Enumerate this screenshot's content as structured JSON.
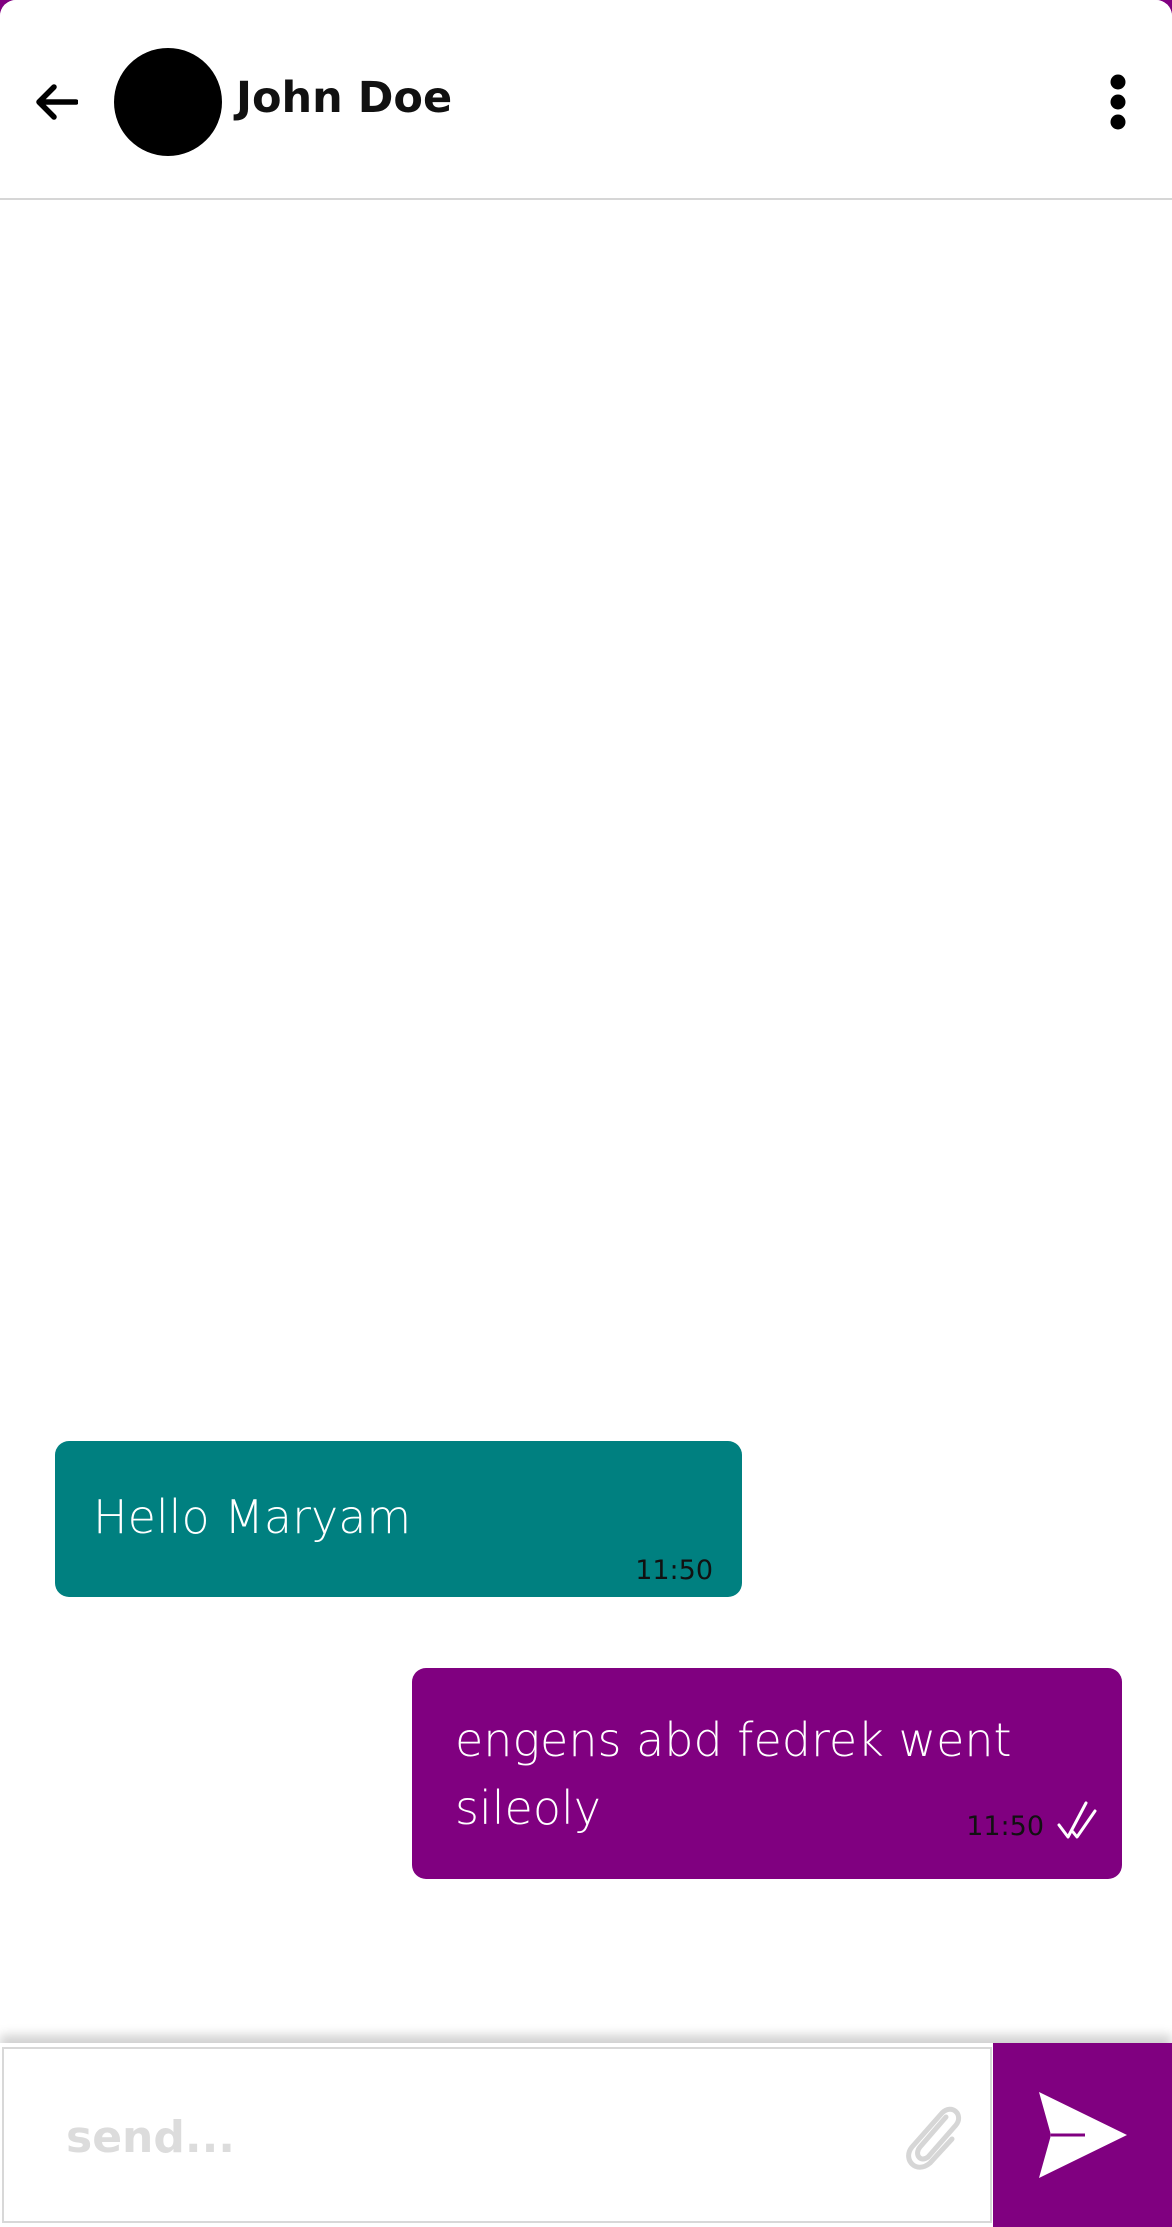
{
  "header": {
    "contact_name": "John Doe"
  },
  "messages": [
    {
      "direction": "incoming",
      "text": "Hello Maryam",
      "time": "11:50",
      "bubble_color": "#008080"
    },
    {
      "direction": "outgoing",
      "text": "engens abd fedrek went sileoly",
      "time": "11:50",
      "bubble_color": "#800080",
      "status_icon": "double-check-icon"
    }
  ],
  "composer": {
    "value": "",
    "placeholder": "send...",
    "attach_icon": "paperclip-icon",
    "send_icon": "send-arrow-icon"
  },
  "colors": {
    "accent": "#800080",
    "incoming_bubble": "#008080"
  },
  "icons": {
    "back": "arrow-left-icon",
    "menu": "more-vertical-icon",
    "avatar": "avatar"
  }
}
